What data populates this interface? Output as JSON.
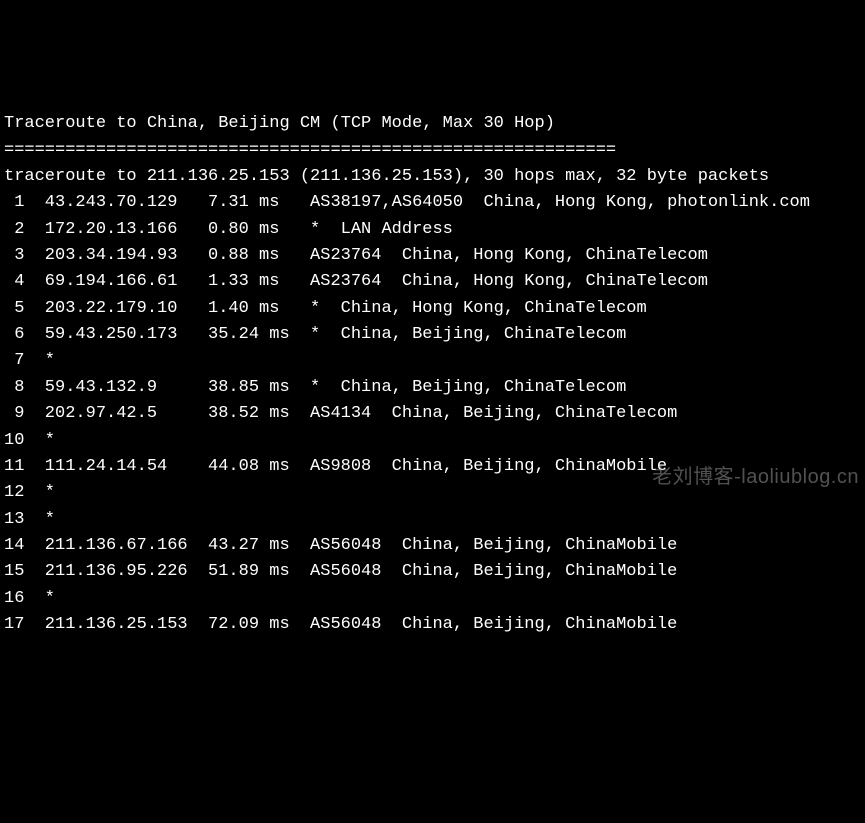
{
  "header": {
    "title": "Traceroute to China, Beijing CM (TCP Mode, Max 30 Hop)",
    "separator": "============================================================",
    "summary": "traceroute to 211.136.25.153 (211.136.25.153), 30 hops max, 32 byte packets"
  },
  "hops": [
    {
      "n": " 1",
      "ip": "43.243.70.129 ",
      "rtt": "7.31 ms ",
      "asn": "AS38197,AS64050",
      "loc": "China, Hong Kong, photonlink.com"
    },
    {
      "n": " 2",
      "ip": "172.20.13.166 ",
      "rtt": "0.80 ms ",
      "asn": "*  LAN Address",
      "loc": ""
    },
    {
      "n": " 3",
      "ip": "203.34.194.93 ",
      "rtt": "0.88 ms ",
      "asn": "AS23764",
      "loc": "China, Hong Kong, ChinaTelecom"
    },
    {
      "n": " 4",
      "ip": "69.194.166.61 ",
      "rtt": "1.33 ms ",
      "asn": "AS23764",
      "loc": "China, Hong Kong, ChinaTelecom"
    },
    {
      "n": " 5",
      "ip": "203.22.179.10 ",
      "rtt": "1.40 ms ",
      "asn": "*",
      "loc": "China, Hong Kong, ChinaTelecom"
    },
    {
      "n": " 6",
      "ip": "59.43.250.173 ",
      "rtt": "35.24 ms",
      "asn": "*",
      "loc": "China, Beijing, ChinaTelecom"
    },
    {
      "n": " 7",
      "ip": "*",
      "rtt": "",
      "asn": "",
      "loc": ""
    },
    {
      "n": " 8",
      "ip": "59.43.132.9   ",
      "rtt": "38.85 ms",
      "asn": "*",
      "loc": "China, Beijing, ChinaTelecom"
    },
    {
      "n": " 9",
      "ip": "202.97.42.5   ",
      "rtt": "38.52 ms",
      "asn": "AS4134",
      "loc": "China, Beijing, ChinaTelecom"
    },
    {
      "n": "10",
      "ip": "*",
      "rtt": "",
      "asn": "",
      "loc": ""
    },
    {
      "n": "11",
      "ip": "111.24.14.54  ",
      "rtt": "44.08 ms",
      "asn": "AS9808",
      "loc": "China, Beijing, ChinaMobile"
    },
    {
      "n": "12",
      "ip": "*",
      "rtt": "",
      "asn": "",
      "loc": ""
    },
    {
      "n": "13",
      "ip": "*",
      "rtt": "",
      "asn": "",
      "loc": ""
    },
    {
      "n": "14",
      "ip": "211.136.67.166",
      "rtt": "43.27 ms",
      "asn": "AS56048",
      "loc": "China, Beijing, ChinaMobile"
    },
    {
      "n": "15",
      "ip": "211.136.95.226",
      "rtt": "51.89 ms",
      "asn": "AS56048",
      "loc": "China, Beijing, ChinaMobile"
    },
    {
      "n": "16",
      "ip": "*",
      "rtt": "",
      "asn": "",
      "loc": ""
    },
    {
      "n": "17",
      "ip": "211.136.25.153",
      "rtt": "72.09 ms",
      "asn": "AS56048",
      "loc": "China, Beijing, ChinaMobile"
    }
  ],
  "watermark": "老刘博客-laoliublog.cn"
}
